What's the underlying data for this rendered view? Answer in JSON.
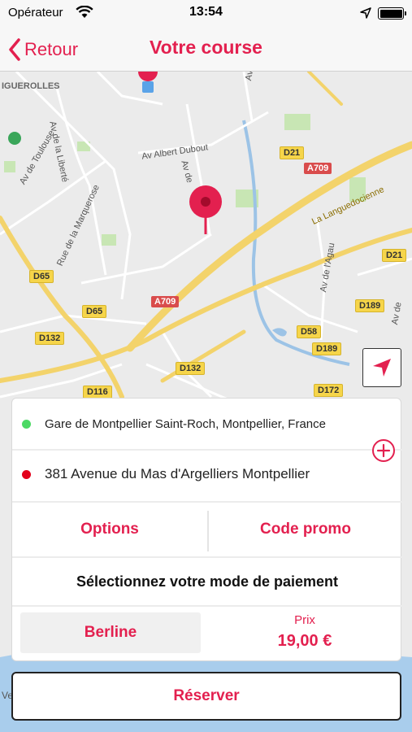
{
  "status_bar": {
    "carrier": "Opérateur",
    "time": "13:54"
  },
  "nav": {
    "back_label": "Retour",
    "title": "Votre course"
  },
  "map": {
    "road_labels": [
      "IGUEROLLES",
      "Av de la Liberté",
      "Av de Toulouse",
      "Av Albert Dubout",
      "Av de",
      "Rue de la Marquerose",
      "Av de",
      "La Languedocienne",
      "Av de l'Agau",
      "Av de"
    ],
    "shields_d": [
      "D21",
      "D21",
      "D65",
      "D65",
      "D132",
      "D132",
      "D189",
      "D58",
      "D189",
      "D116",
      "D172"
    ],
    "shields_a": [
      "A709",
      "A709"
    ],
    "bottom_left_text": "Ve"
  },
  "trip": {
    "pickup": "Gare de Montpellier Saint-Roch, Montpellier, France",
    "dropoff": "381 Avenue du Mas d'Argelliers Montpellier",
    "pickup_color": "#4cd964",
    "dropoff_color": "#e3001b"
  },
  "actions": {
    "options": "Options",
    "promo": "Code promo"
  },
  "payment": {
    "label": "Sélectionnez votre mode de paiement"
  },
  "vehicle": {
    "label": "Berline"
  },
  "price": {
    "label": "Prix",
    "value": "19,00 €"
  },
  "reserve": {
    "label": "Réserver"
  },
  "colors": {
    "accent": "#e3204f"
  }
}
